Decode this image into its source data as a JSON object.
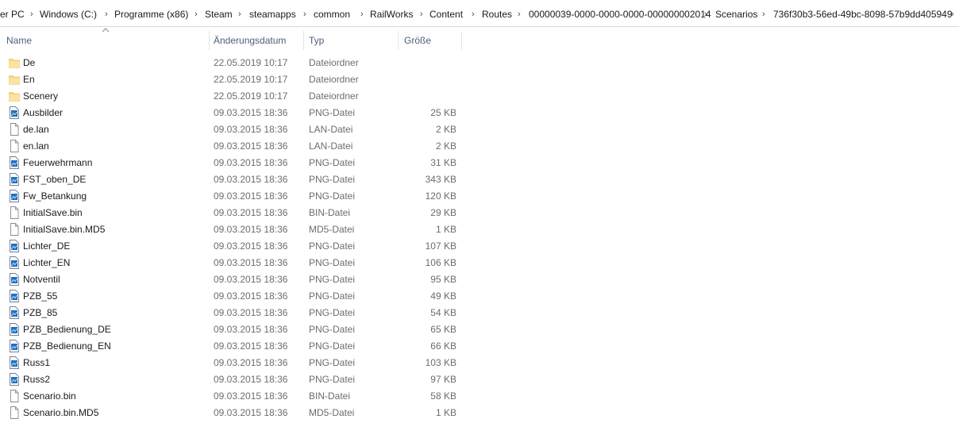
{
  "breadcrumb": [
    "er PC",
    "Windows (C:)",
    "Programme (x86)",
    "Steam",
    "steamapps",
    "common",
    "RailWorks",
    "Content",
    "Routes",
    "00000039-0000-0000-0000-000000002014",
    "Scenarios",
    "736f30b3-56ed-49bc-8098-57b9dd405949"
  ],
  "columns": {
    "name": "Name",
    "date": "Änderungsdatum",
    "type": "Typ",
    "size": "Größe"
  },
  "colors": {
    "folder": "#f8d775",
    "png_icon": "#1f6fbf",
    "header_text": "#4c607a",
    "meta_text": "#6d6d6d"
  },
  "files": [
    {
      "name": "De",
      "date": "22.05.2019 10:17",
      "type": "Dateiordner",
      "size": "",
      "icon": "folder-icon"
    },
    {
      "name": "En",
      "date": "22.05.2019 10:17",
      "type": "Dateiordner",
      "size": "",
      "icon": "folder-icon"
    },
    {
      "name": "Scenery",
      "date": "22.05.2019 10:17",
      "type": "Dateiordner",
      "size": "",
      "icon": "folder-icon"
    },
    {
      "name": "Ausbilder",
      "date": "09.03.2015 18:36",
      "type": "PNG-Datei",
      "size": "25 KB",
      "icon": "image-file-icon"
    },
    {
      "name": "de.lan",
      "date": "09.03.2015 18:36",
      "type": "LAN-Datei",
      "size": "2 KB",
      "icon": "file-icon"
    },
    {
      "name": "en.lan",
      "date": "09.03.2015 18:36",
      "type": "LAN-Datei",
      "size": "2 KB",
      "icon": "file-icon"
    },
    {
      "name": "Feuerwehrmann",
      "date": "09.03.2015 18:36",
      "type": "PNG-Datei",
      "size": "31 KB",
      "icon": "image-file-icon"
    },
    {
      "name": "FST_oben_DE",
      "date": "09.03.2015 18:36",
      "type": "PNG-Datei",
      "size": "343 KB",
      "icon": "image-file-icon"
    },
    {
      "name": "Fw_Betankung",
      "date": "09.03.2015 18:36",
      "type": "PNG-Datei",
      "size": "120 KB",
      "icon": "image-file-icon"
    },
    {
      "name": "InitialSave.bin",
      "date": "09.03.2015 18:36",
      "type": "BIN-Datei",
      "size": "29 KB",
      "icon": "file-icon"
    },
    {
      "name": "InitialSave.bin.MD5",
      "date": "09.03.2015 18:36",
      "type": "MD5-Datei",
      "size": "1 KB",
      "icon": "file-icon"
    },
    {
      "name": "Lichter_DE",
      "date": "09.03.2015 18:36",
      "type": "PNG-Datei",
      "size": "107 KB",
      "icon": "image-file-icon"
    },
    {
      "name": "Lichter_EN",
      "date": "09.03.2015 18:36",
      "type": "PNG-Datei",
      "size": "106 KB",
      "icon": "image-file-icon"
    },
    {
      "name": "Notventil",
      "date": "09.03.2015 18:36",
      "type": "PNG-Datei",
      "size": "95 KB",
      "icon": "image-file-icon"
    },
    {
      "name": "PZB_55",
      "date": "09.03.2015 18:36",
      "type": "PNG-Datei",
      "size": "49 KB",
      "icon": "image-file-icon"
    },
    {
      "name": "PZB_85",
      "date": "09.03.2015 18:36",
      "type": "PNG-Datei",
      "size": "54 KB",
      "icon": "image-file-icon"
    },
    {
      "name": "PZB_Bedienung_DE",
      "date": "09.03.2015 18:36",
      "type": "PNG-Datei",
      "size": "65 KB",
      "icon": "image-file-icon"
    },
    {
      "name": "PZB_Bedienung_EN",
      "date": "09.03.2015 18:36",
      "type": "PNG-Datei",
      "size": "66 KB",
      "icon": "image-file-icon"
    },
    {
      "name": "Russ1",
      "date": "09.03.2015 18:36",
      "type": "PNG-Datei",
      "size": "103 KB",
      "icon": "image-file-icon"
    },
    {
      "name": "Russ2",
      "date": "09.03.2015 18:36",
      "type": "PNG-Datei",
      "size": "97 KB",
      "icon": "image-file-icon"
    },
    {
      "name": "Scenario.bin",
      "date": "09.03.2015 18:36",
      "type": "BIN-Datei",
      "size": "58 KB",
      "icon": "file-icon"
    },
    {
      "name": "Scenario.bin.MD5",
      "date": "09.03.2015 18:36",
      "type": "MD5-Datei",
      "size": "1 KB",
      "icon": "file-icon"
    }
  ]
}
